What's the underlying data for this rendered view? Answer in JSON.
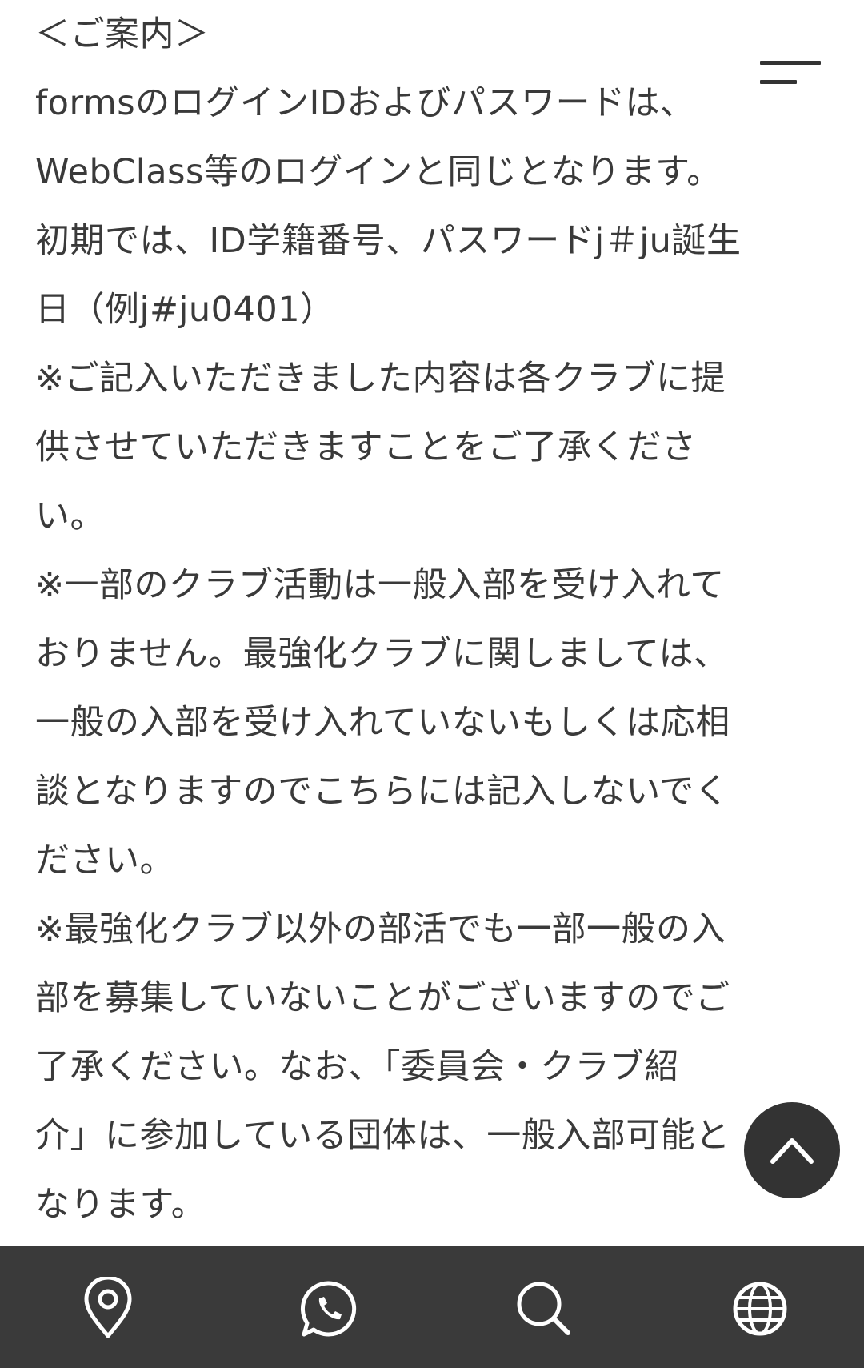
{
  "content": {
    "lines": [
      "＜ご案内＞",
      "formsのログインIDおよびパスワードは、",
      "WebClass等のログインと同じとなります。",
      "初期では、ID学籍番号、パスワードj＃ju誕生",
      "日（例j#ju0401）",
      "※ご記入いただきました内容は各クラブに提",
      "供させていただきますことをご了承くださ",
      "い。",
      "※一部のクラブ活動は一般入部を受け入れて",
      "おりません。最強化クラブに関しましては、",
      "一般の入部を受け入れていないもしくは応相",
      "談となりますのでこちらには記入しないでく",
      "ださい。",
      "※最強化クラブ以外の部活でも一部一般の入",
      "部を募集していないことがございますのでご",
      "了承ください。なお、「委員会・クラブ紹",
      "介」に参加している団体は、一般入部可能と",
      "なります。"
    ]
  },
  "icons": {
    "menu": "hamburger-menu-icon",
    "scroll_top": "chevron-up-icon",
    "nav": [
      "map-pin-icon",
      "phone-chat-icon",
      "search-icon",
      "globe-icon"
    ]
  },
  "colors": {
    "text": "#3a3a3a",
    "nav_background": "#3a3a3a",
    "icon_light": "#ffffff",
    "button_dark": "#333333"
  }
}
